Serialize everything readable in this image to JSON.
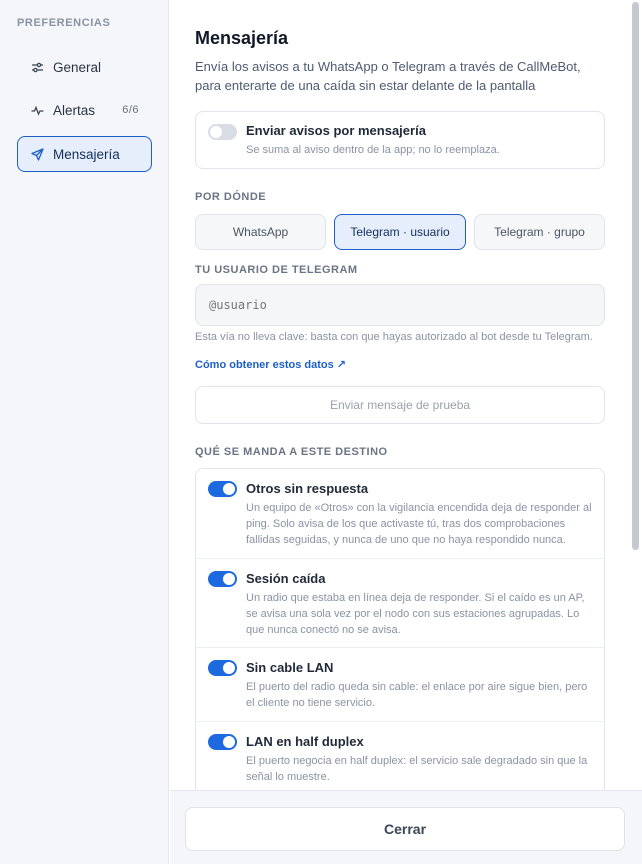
{
  "sidebar": {
    "title": "PREFERENCIAS",
    "items": [
      {
        "label": "General",
        "icon": "sliders-icon"
      },
      {
        "label": "Alertas",
        "icon": "pulse-icon",
        "count": "6/6"
      },
      {
        "label": "Mensajería",
        "icon": "send-icon",
        "active": true
      }
    ]
  },
  "main": {
    "title": "Mensajería",
    "description": "Envía los avisos a tu WhatsApp o Telegram a través de CallMeBot, para enterarte de una caída sin estar delante de la pantalla",
    "enable": {
      "title": "Enviar avisos por mensajería",
      "subtitle": "Se suma al aviso dentro de la app; no lo reemplaza.",
      "enabled": false
    },
    "channel_label": "POR DÓNDE",
    "channels": [
      "WhatsApp",
      "Telegram · usuario",
      "Telegram · grupo"
    ],
    "selected_channel": "Telegram · usuario",
    "user_label": "TU USUARIO DE TELEGRAM",
    "user_placeholder": "@usuario",
    "user_value": "",
    "hint": "Esta vía no lleva clave: basta con que hayas autorizado al bot desde tu Telegram.",
    "help_link": "Cómo obtener estos datos ↗",
    "test_button": "Enviar mensaje de prueba",
    "destination_label": "QUÉ SE MANDA A ESTE DESTINO",
    "alerts": [
      {
        "title": "Otros sin respuesta",
        "desc": "Un equipo de «Otros» con la vigilancia encendida deja de responder al ping. Solo avisa de los que activaste tú, tras dos comprobaciones fallidas seguidas, y nunca de uno que no haya respondido nunca.",
        "enabled": true
      },
      {
        "title": "Sesión caída",
        "desc": "Un radio que estaba en línea deja de responder. Si el caído es un AP, se avisa una sola vez por el nodo con sus estaciones agrupadas. Lo que nunca conectó no se avisa.",
        "enabled": true
      },
      {
        "title": "Sin cable LAN",
        "desc": "El puerto del radio queda sin cable: el enlace por aire sigue bien, pero el cliente no tiene servicio.",
        "enabled": true
      },
      {
        "title": "LAN en half duplex",
        "desc": "El puerto negocia en half duplex: el servicio sale degradado sin que la señal lo muestre.",
        "enabled": true
      }
    ]
  },
  "footer": {
    "close_label": "Cerrar"
  },
  "colors": {
    "accent": "#1d6ae0",
    "active_bg": "#e7eefb",
    "sidebar_bg": "#f4f6f9"
  }
}
